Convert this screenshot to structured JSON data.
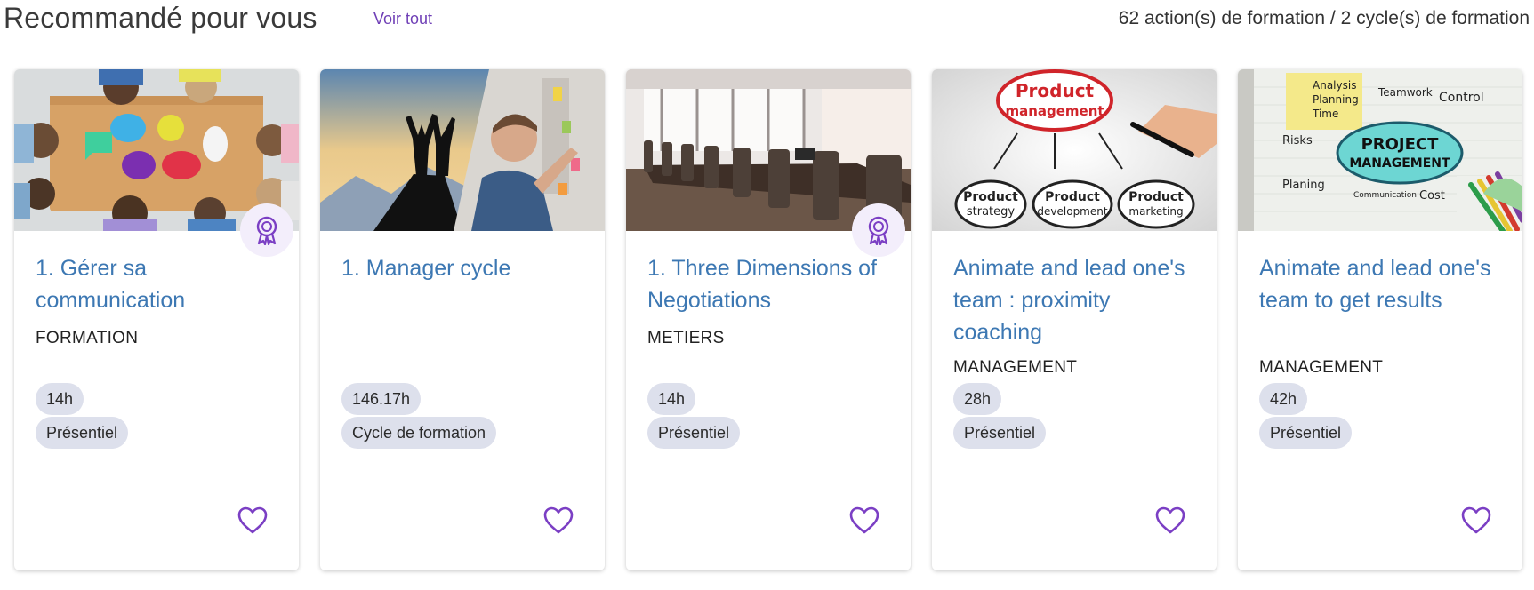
{
  "header": {
    "title": "Recommandé pour vous",
    "see_all": "Voir tout",
    "count": "62 action(s) de formation / 2 cycle(s) de formation"
  },
  "colors": {
    "accent": "#6f3fb6",
    "title_link": "#3d78b3",
    "chip_bg": "#dde0ec"
  },
  "cards": [
    {
      "title": "1. Gérer sa communication",
      "category": "FORMATION",
      "duration": "14h",
      "mode": "Présentiel",
      "has_badge": true,
      "image_text": []
    },
    {
      "title": "1. Manager cycle",
      "category": "",
      "duration": "146.17h",
      "mode": "Cycle de formation",
      "has_badge": false,
      "image_text": []
    },
    {
      "title": "1. Three Dimensions of Negotiations",
      "category": "METIERS",
      "duration": "14h",
      "mode": "Présentiel",
      "has_badge": true,
      "image_text": []
    },
    {
      "title": "Animate and lead one's team : proximity coaching",
      "category": "MANAGEMENT",
      "duration": "28h",
      "mode": "Présentiel",
      "has_badge": false,
      "image_text": [
        "Product",
        "management",
        "Product",
        "strategy",
        "Product",
        "development",
        "Product",
        "marketing"
      ]
    },
    {
      "title": "Animate and lead one's team to get results",
      "category": "MANAGEMENT",
      "duration": "42h",
      "mode": "Présentiel",
      "has_badge": false,
      "image_text": [
        "PROJECT",
        "MANAGEMENT",
        "Analysis",
        "Planning",
        "Time",
        "Teamwork",
        "Control",
        "Risks",
        "Planing",
        "Communication",
        "Cost"
      ]
    }
  ]
}
